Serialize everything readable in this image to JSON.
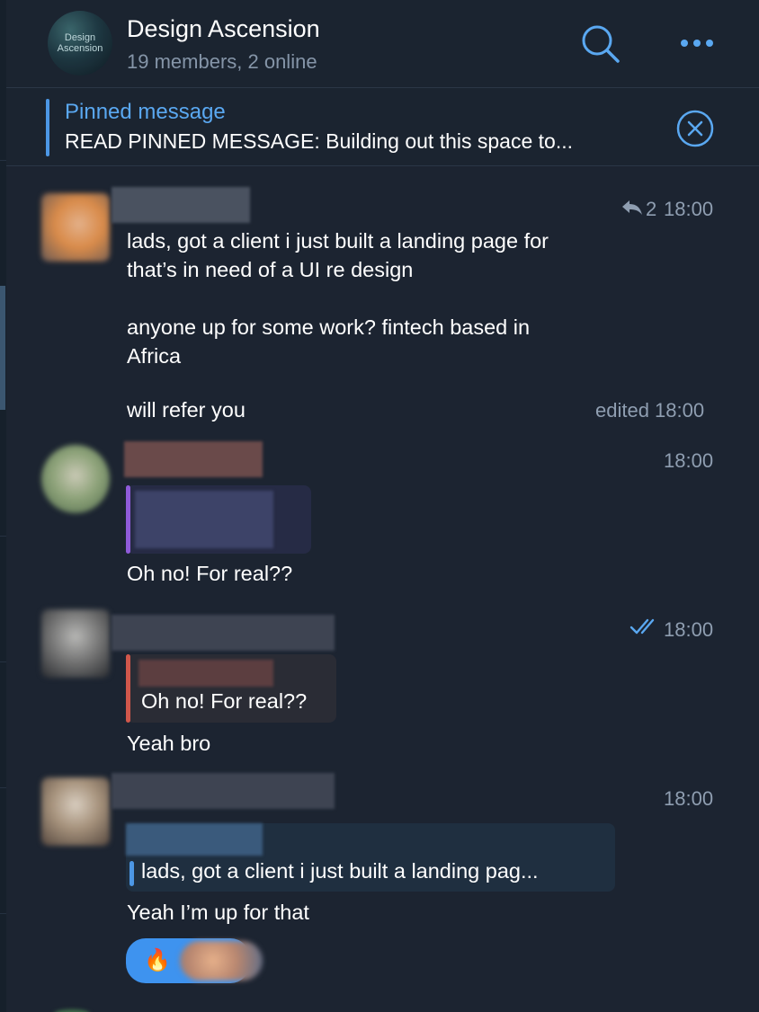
{
  "header": {
    "avatar_text_line1": "Design",
    "avatar_text_line2": "Ascension",
    "title": "Design Ascension",
    "subtitle": "19 members, 2 online",
    "search_icon": "search-icon",
    "more_icon": "more-dots-icon"
  },
  "pinned": {
    "title": "Pinned message",
    "text": "READ PINNED MESSAGE:  Building out this space to...",
    "close_icon": "close-circle-icon"
  },
  "messages": [
    {
      "time": "18:00",
      "reply_count": "2",
      "text1": "lads, got a client i just built a landing page for",
      "text2": "that’s in need of a UI re design",
      "text3": "anyone up for some work? fintech based in",
      "text4": "Africa",
      "text5": "will refer you",
      "edited": "edited 18:00"
    },
    {
      "time": "18:00",
      "text": "Oh no! For real??"
    },
    {
      "time": "18:00",
      "status_icon": "double-check-icon",
      "reply_text": "Oh no! For real??",
      "text": "Yeah bro"
    },
    {
      "time": "18:00",
      "reply_text": "lads, got a client i just built a landing pag...",
      "text": "Yeah I’m up for that",
      "reaction_emoji": "🔥"
    }
  ],
  "colors": {
    "background": "#1c2431",
    "accent": "#4c97e5",
    "reply_red": "#d0574b",
    "reply_purple": "#8f5bd9"
  }
}
